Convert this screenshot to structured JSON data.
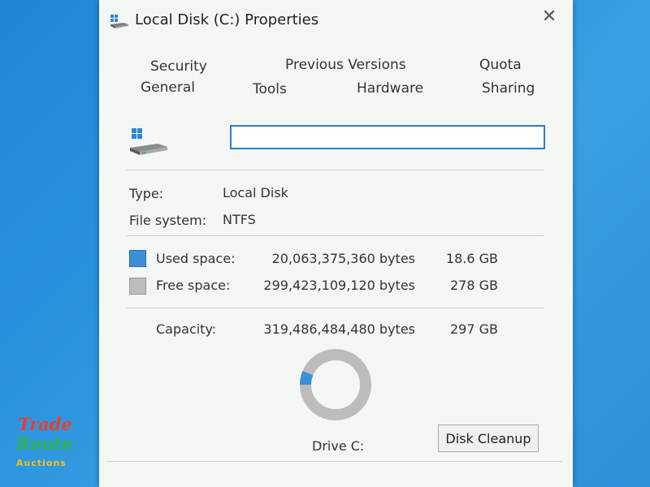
{
  "window": {
    "title": "Local Disk (C:) Properties",
    "close_glyph": "✕"
  },
  "tabs": {
    "row1": [
      "Security",
      "Previous Versions",
      "Quota"
    ],
    "row2": [
      "General",
      "Tools",
      "Hardware",
      "Sharing"
    ]
  },
  "general": {
    "name_value": "",
    "type_label": "Type:",
    "type_value": "Local Disk",
    "fs_label": "File system:",
    "fs_value": "NTFS",
    "used_label": "Used space:",
    "used_bytes": "20,063,375,360 bytes",
    "used_size": "18.6 GB",
    "free_label": "Free space:",
    "free_bytes": "299,423,109,120 bytes",
    "free_size": "278 GB",
    "capacity_label": "Capacity:",
    "capacity_bytes": "319,486,484,480 bytes",
    "capacity_size": "297 GB",
    "drive_label": "Drive C:",
    "cleanup_label": "Disk Cleanup",
    "used_fraction": 0.063
  },
  "colors": {
    "used": "#3c8fd6",
    "free": "#bcbcbc",
    "input_border": "#2a7fc7"
  },
  "icons": [
    "drive-icon",
    "close-icon",
    "windows-logo-icon"
  ],
  "watermark": {
    "line1": "Trade",
    "line2": "Route",
    "line3": "Auctions"
  }
}
